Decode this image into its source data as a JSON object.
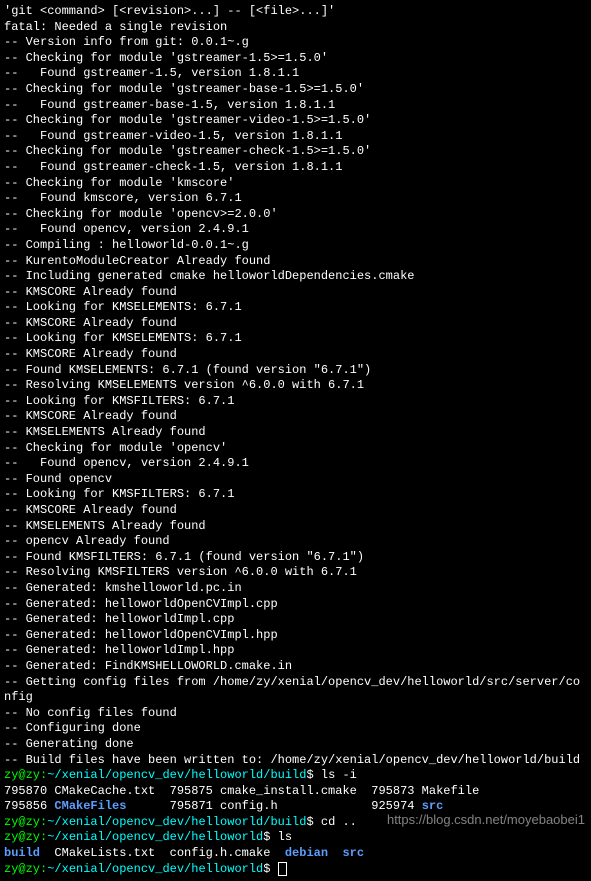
{
  "lines": [
    {
      "segs": [
        {
          "t": "'git <command> [<revision>...] -- [<file>...]'"
        }
      ]
    },
    {
      "segs": [
        {
          "t": "fatal: Needed a single revision"
        }
      ]
    },
    {
      "segs": [
        {
          "t": "-- Version info from git: 0.0.1~.g"
        }
      ]
    },
    {
      "segs": [
        {
          "t": "-- Checking for module 'gstreamer-1.5>=1.5.0'"
        }
      ]
    },
    {
      "segs": [
        {
          "t": "--   Found gstreamer-1.5, version 1.8.1.1"
        }
      ]
    },
    {
      "segs": [
        {
          "t": "-- Checking for module 'gstreamer-base-1.5>=1.5.0'"
        }
      ]
    },
    {
      "segs": [
        {
          "t": "--   Found gstreamer-base-1.5, version 1.8.1.1"
        }
      ]
    },
    {
      "segs": [
        {
          "t": "-- Checking for module 'gstreamer-video-1.5>=1.5.0'"
        }
      ]
    },
    {
      "segs": [
        {
          "t": "--   Found gstreamer-video-1.5, version 1.8.1.1"
        }
      ]
    },
    {
      "segs": [
        {
          "t": "-- Checking for module 'gstreamer-check-1.5>=1.5.0'"
        }
      ]
    },
    {
      "segs": [
        {
          "t": "--   Found gstreamer-check-1.5, version 1.8.1.1"
        }
      ]
    },
    {
      "segs": [
        {
          "t": "-- Checking for module 'kmscore'"
        }
      ]
    },
    {
      "segs": [
        {
          "t": "--   Found kmscore, version 6.7.1"
        }
      ]
    },
    {
      "segs": [
        {
          "t": "-- Checking for module 'opencv>=2.0.0'"
        }
      ]
    },
    {
      "segs": [
        {
          "t": "--   Found opencv, version 2.4.9.1"
        }
      ]
    },
    {
      "segs": [
        {
          "t": "-- Compiling : helloworld-0.0.1~.g"
        }
      ]
    },
    {
      "segs": [
        {
          "t": "-- KurentoModuleCreator Already found"
        }
      ]
    },
    {
      "segs": [
        {
          "t": "-- Including generated cmake helloworldDependencies.cmake"
        }
      ]
    },
    {
      "segs": [
        {
          "t": "-- KMSCORE Already found"
        }
      ]
    },
    {
      "segs": [
        {
          "t": "-- Looking for KMSELEMENTS: 6.7.1"
        }
      ]
    },
    {
      "segs": [
        {
          "t": "-- KMSCORE Already found"
        }
      ]
    },
    {
      "segs": [
        {
          "t": "-- Looking for KMSELEMENTS: 6.7.1"
        }
      ]
    },
    {
      "segs": [
        {
          "t": "-- KMSCORE Already found"
        }
      ]
    },
    {
      "segs": [
        {
          "t": "-- Found KMSELEMENTS: 6.7.1 (found version \"6.7.1\")"
        }
      ]
    },
    {
      "segs": [
        {
          "t": "-- Resolving KMSELEMENTS version ^6.0.0 with 6.7.1"
        }
      ]
    },
    {
      "segs": [
        {
          "t": "-- Looking for KMSFILTERS: 6.7.1"
        }
      ]
    },
    {
      "segs": [
        {
          "t": "-- KMSCORE Already found"
        }
      ]
    },
    {
      "segs": [
        {
          "t": "-- KMSELEMENTS Already found"
        }
      ]
    },
    {
      "segs": [
        {
          "t": "-- Checking for module 'opencv'"
        }
      ]
    },
    {
      "segs": [
        {
          "t": "--   Found opencv, version 2.4.9.1"
        }
      ]
    },
    {
      "segs": [
        {
          "t": "-- Found opencv"
        }
      ]
    },
    {
      "segs": [
        {
          "t": "-- Looking for KMSFILTERS: 6.7.1"
        }
      ]
    },
    {
      "segs": [
        {
          "t": "-- KMSCORE Already found"
        }
      ]
    },
    {
      "segs": [
        {
          "t": "-- KMSELEMENTS Already found"
        }
      ]
    },
    {
      "segs": [
        {
          "t": "-- opencv Already found"
        }
      ]
    },
    {
      "segs": [
        {
          "t": "-- Found KMSFILTERS: 6.7.1 (found version \"6.7.1\")"
        }
      ]
    },
    {
      "segs": [
        {
          "t": "-- Resolving KMSFILTERS version ^6.0.0 with 6.7.1"
        }
      ]
    },
    {
      "segs": [
        {
          "t": "-- Generated: kmshelloworld.pc.in"
        }
      ]
    },
    {
      "segs": [
        {
          "t": "-- Generated: helloworldOpenCVImpl.cpp"
        }
      ]
    },
    {
      "segs": [
        {
          "t": "-- Generated: helloworldImpl.cpp"
        }
      ]
    },
    {
      "segs": [
        {
          "t": "-- Generated: helloworldOpenCVImpl.hpp"
        }
      ]
    },
    {
      "segs": [
        {
          "t": "-- Generated: helloworldImpl.hpp"
        }
      ]
    },
    {
      "segs": [
        {
          "t": "-- Generated: FindKMSHELLOWORLD.cmake.in"
        }
      ]
    },
    {
      "segs": [
        {
          "t": "-- Getting config files from /home/zy/xenial/opencv_dev/helloworld/src/server/config"
        }
      ]
    },
    {
      "segs": [
        {
          "t": "-- No config files found"
        }
      ]
    },
    {
      "segs": [
        {
          "t": "-- Configuring done"
        }
      ]
    },
    {
      "segs": [
        {
          "t": "-- Generating done"
        }
      ]
    },
    {
      "segs": [
        {
          "t": "-- Build files have been written to: /home/zy/xenial/opencv_dev/helloworld/build"
        }
      ]
    },
    {
      "segs": [
        {
          "t": "zy@zy:",
          "c": "green"
        },
        {
          "t": "~/xenial/opencv_dev/helloworld/build",
          "c": "cyan"
        },
        {
          "t": "$ ls -i"
        }
      ]
    },
    {
      "segs": [
        {
          "t": "795870 CMakeCache.txt  795875 cmake_install.cmake  795873 Makefile"
        }
      ]
    },
    {
      "segs": [
        {
          "t": "795856 "
        },
        {
          "t": "CMakeFiles",
          "c": "blue"
        },
        {
          "t": "      795871 config.h             925974 "
        },
        {
          "t": "src",
          "c": "blue"
        }
      ]
    },
    {
      "segs": [
        {
          "t": "zy@zy:",
          "c": "green"
        },
        {
          "t": "~/xenial/opencv_dev/helloworld/build",
          "c": "cyan"
        },
        {
          "t": "$ cd .."
        }
      ]
    },
    {
      "segs": [
        {
          "t": "zy@zy:",
          "c": "green"
        },
        {
          "t": "~/xenial/opencv_dev/helloworld",
          "c": "cyan"
        },
        {
          "t": "$ ls"
        }
      ]
    },
    {
      "segs": [
        {
          "t": "build",
          "c": "blue"
        },
        {
          "t": "  CMakeLists.txt  config.h.cmake  "
        },
        {
          "t": "debian",
          "c": "blue"
        },
        {
          "t": "  "
        },
        {
          "t": "src",
          "c": "blue"
        }
      ]
    },
    {
      "segs": [
        {
          "t": "zy@zy:",
          "c": "green"
        },
        {
          "t": "~/xenial/opencv_dev/helloworld",
          "c": "cyan"
        },
        {
          "t": "$ "
        }
      ],
      "cursor": true
    }
  ],
  "watermark": "https://blog.csdn.net/moyebaobei1"
}
